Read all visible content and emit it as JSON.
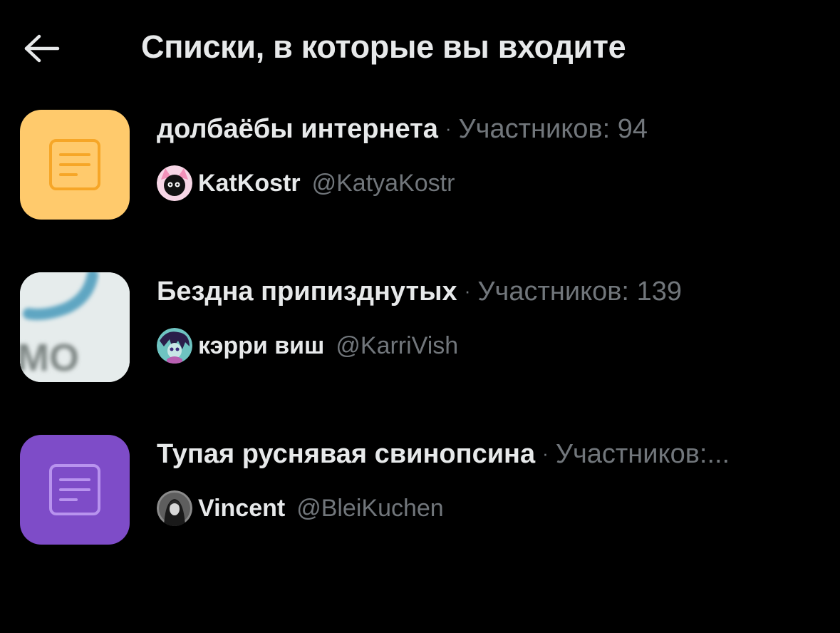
{
  "header": {
    "title": "Списки, в которые вы входите",
    "back_icon": "arrow-left-icon"
  },
  "lists": [
    {
      "name": "долбаёбы интернета",
      "separator": "·",
      "members_label": "Участников:",
      "members_count": "94",
      "owner_name": "KatKostr",
      "owner_handle": "@KatyaKostr",
      "thumbnail": "list-doc-icon",
      "thumb_color": "#FFCA6C",
      "thumb_icon_color": "#F6A627"
    },
    {
      "name": "Бездна припизднутых",
      "separator": "·",
      "members_label": "Участников:",
      "members_count": "139",
      "owner_name": "кэрри виш",
      "owner_handle": "@KarriVish",
      "thumbnail": "custom-photo",
      "thumb_color": "#E8EEEF"
    },
    {
      "name": "Тупая руснявая свинопсина",
      "separator": "·",
      "members_label": "Участников:...",
      "members_count": "",
      "owner_name": "Vincent",
      "owner_handle": "@BleiKuchen",
      "thumbnail": "list-doc-icon",
      "thumb_color": "#7E4CC8",
      "thumb_icon_color": "#B893EE"
    }
  ],
  "colors": {
    "background": "#000000",
    "primary_text": "#E7E9EA",
    "secondary_text": "#71767B"
  }
}
